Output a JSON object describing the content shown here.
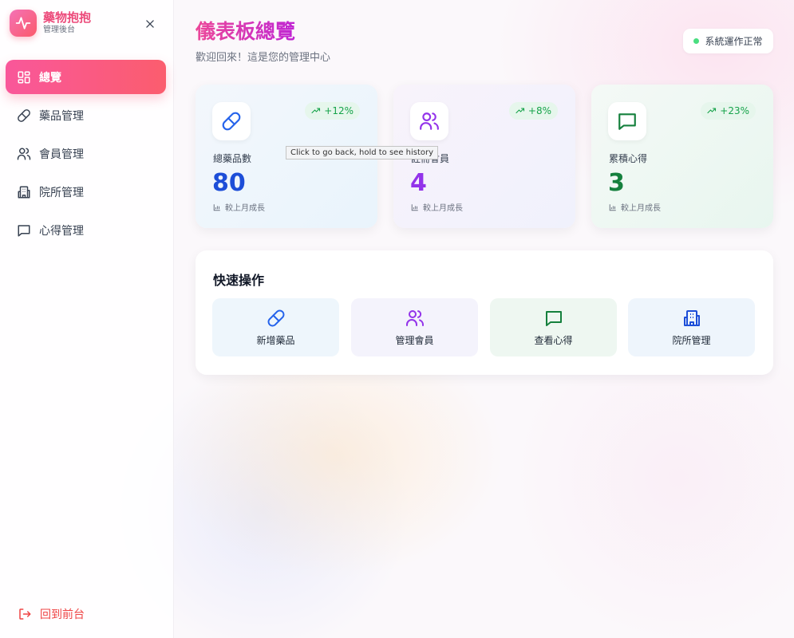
{
  "brand": {
    "title": "藥物抱抱",
    "subtitle": "管理後台"
  },
  "sidebar": {
    "items": [
      {
        "label": "總覽",
        "icon": "grid-icon",
        "active": true
      },
      {
        "label": "藥品管理",
        "icon": "pill-icon"
      },
      {
        "label": "會員管理",
        "icon": "users-icon"
      },
      {
        "label": "院所管理",
        "icon": "building-icon"
      },
      {
        "label": "心得管理",
        "icon": "message-icon"
      }
    ],
    "back_label": "回到前台"
  },
  "header": {
    "title": "儀表板總覽",
    "subtitle": "歡迎回來！這是您的管理中心",
    "status": "系統運作正常"
  },
  "stats": [
    {
      "label": "總藥品數",
      "value": "80",
      "trend": "+12%",
      "footer": "較上月成長"
    },
    {
      "label": "註冊會員",
      "value": "4",
      "trend": "+8%",
      "footer": "較上月成長"
    },
    {
      "label": "累積心得",
      "value": "3",
      "trend": "+23%",
      "footer": "較上月成長"
    }
  ],
  "tooltip": "Click to go back, hold to see history",
  "quick": {
    "title": "快速操作",
    "actions": [
      {
        "label": "新增藥品"
      },
      {
        "label": "管理會員"
      },
      {
        "label": "查看心得"
      },
      {
        "label": "院所管理"
      }
    ]
  },
  "colors": {
    "accent": "#f9579a",
    "blue": "#1d4ed8",
    "purple": "#9333ea",
    "green": "#15803d",
    "success": "#16a34a"
  }
}
